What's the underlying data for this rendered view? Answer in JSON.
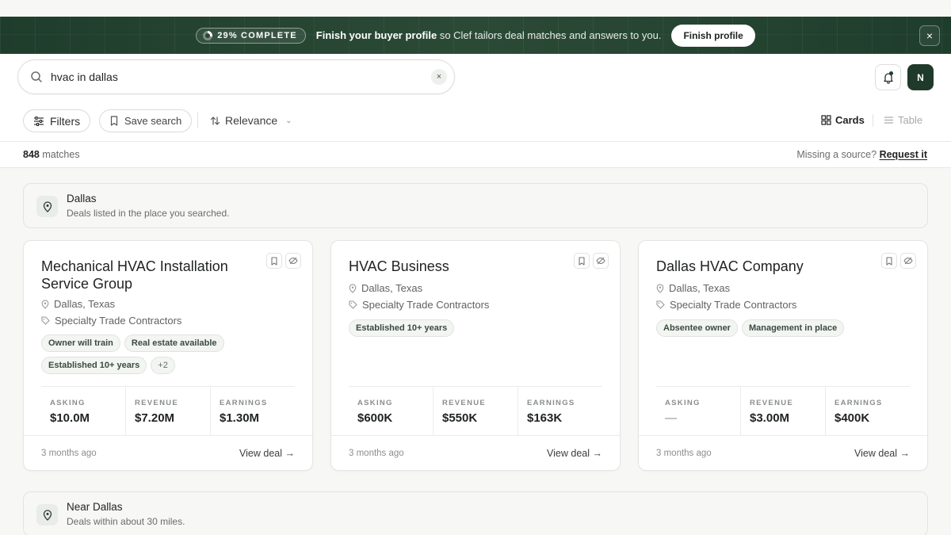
{
  "banner": {
    "progress": "29% COMPLETE",
    "progress_fraction": 0.29,
    "headline": "Finish your buyer profile",
    "rest": " so Clef tailors deal matches and answers to you.",
    "button": "Finish profile",
    "close": "×"
  },
  "search": {
    "value": "hvac in dallas",
    "clear": "×"
  },
  "user": {
    "initial": "N"
  },
  "toolbar": {
    "filters": "Filters",
    "save_search": "Save search",
    "sort": "Relevance",
    "view_cards": "Cards",
    "view_table": "Table"
  },
  "results": {
    "count": "848",
    "count_suffix": "matches",
    "missing_prompt": "Missing a source?",
    "request_link": "Request it"
  },
  "sections": [
    {
      "title": "Dallas",
      "subtitle": "Deals listed in the place you searched."
    },
    {
      "title": "Near Dallas",
      "subtitle": "Deals within about 30 miles."
    }
  ],
  "labels": {
    "asking": "ASKING",
    "revenue": "REVENUE",
    "earnings": "EARNINGS",
    "view_deal": "View deal →"
  },
  "cards": [
    {
      "title": "Mechanical HVAC Installation Service Group",
      "location": "Dallas, Texas",
      "industry": "Specialty Trade Contractors",
      "tags": [
        "Owner will train",
        "Real estate available",
        "Established 10+ years"
      ],
      "more": "+2",
      "asking": "$10.0M",
      "revenue": "$7.20M",
      "earnings": "$1.30M",
      "posted": "3 months ago"
    },
    {
      "title": "HVAC Business",
      "location": "Dallas, Texas",
      "industry": "Specialty Trade Contractors",
      "tags": [
        "Established 10+ years"
      ],
      "more": "",
      "asking": "$600K",
      "revenue": "$550K",
      "earnings": "$163K",
      "posted": "3 months ago"
    },
    {
      "title": "Dallas HVAC Company",
      "location": "Dallas, Texas",
      "industry": "Specialty Trade Contractors",
      "tags": [
        "Absentee owner",
        "Management in place"
      ],
      "more": "",
      "asking": "—",
      "revenue": "$3.00M",
      "earnings": "$400K",
      "posted": "3 months ago"
    }
  ]
}
